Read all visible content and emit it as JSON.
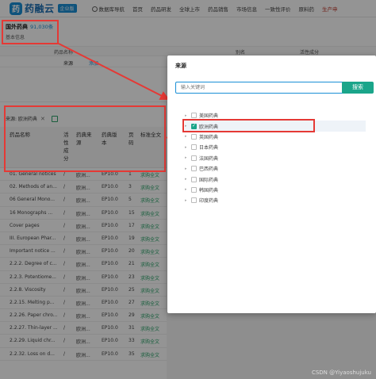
{
  "app": {
    "logo_char": "药",
    "logo_text": "药融云",
    "badge": "企业版",
    "nav": [
      "数据库导航",
      "首页",
      "药品研发",
      "全球上市",
      "药品销售",
      "市场信息",
      "一致性评价",
      "原料药",
      "生产申"
    ]
  },
  "page": {
    "title": "国外药典",
    "count": "91,030条",
    "basic_info": "基本信息"
  },
  "upper_table": {
    "headers": [
      "药品名称",
      "别名",
      "活性成分"
    ],
    "row": {
      "source": "来源",
      "link": "添加"
    }
  },
  "filter": {
    "tag": "来源: 欧洲药典",
    "close": "✕"
  },
  "grid": {
    "headers": [
      "药品名称",
      "活\n性\n成\n分",
      "药典来\n源",
      "药典版\n本",
      "页\n码",
      "标准全文"
    ],
    "rows": [
      [
        "01. General notices",
        "/",
        "欧洲...",
        "EP10.0",
        "1",
        "求购全文"
      ],
      [
        "02. Methods of an...",
        "/",
        "欧洲...",
        "EP10.0",
        "3",
        "求购全文"
      ],
      [
        "06 General Mono...",
        "/",
        "欧洲...",
        "EP10.0",
        "5",
        "求购全文"
      ],
      [
        "16 Monographs ...",
        "/",
        "欧洲...",
        "EP10.0",
        "15",
        "求购全文"
      ],
      [
        "Cover pages",
        "/",
        "欧洲...",
        "EP10.0",
        "17",
        "求购全文"
      ],
      [
        "III. European Phar...",
        "/",
        "欧洲...",
        "EP10.0",
        "19",
        "求购全文"
      ],
      [
        "Important notice ...",
        "/",
        "欧洲...",
        "EP10.0",
        "20",
        "求购全文"
      ],
      [
        "2.2.2. Degree of c...",
        "/",
        "欧洲...",
        "EP10.0",
        "21",
        "求购全文"
      ],
      [
        "2.2.3. Potentiome...",
        "/",
        "欧洲...",
        "EP10.0",
        "23",
        "求购全文"
      ],
      [
        "2.2.8. Viscosity",
        "/",
        "欧洲...",
        "EP10.0",
        "25",
        "求购全文"
      ],
      [
        "2.2.15. Melting p...",
        "/",
        "欧洲...",
        "EP10.0",
        "27",
        "求购全文"
      ],
      [
        "2.2.26. Paper chro...",
        "/",
        "欧洲...",
        "EP10.0",
        "29",
        "求购全文"
      ],
      [
        "2.2.27. Thin-layer ...",
        "/",
        "欧洲...",
        "EP10.0",
        "31",
        "求购全文"
      ],
      [
        "2.2.29. Liquid chr...",
        "/",
        "欧洲...",
        "EP10.0",
        "33",
        "求购全文"
      ],
      [
        "2.2.32. Loss on d...",
        "/",
        "欧洲...",
        "EP10.0",
        "35",
        "求购全文"
      ]
    ]
  },
  "dialog": {
    "title": "来源",
    "search_placeholder": "输入关键词",
    "search_button": "搜索",
    "items": [
      {
        "label": "美国药典",
        "checked": false
      },
      {
        "label": "欧洲药典",
        "checked": true
      },
      {
        "label": "英国药典",
        "checked": false
      },
      {
        "label": "日本药典",
        "checked": false
      },
      {
        "label": "法国药典",
        "checked": false
      },
      {
        "label": "巴西药典",
        "checked": false
      },
      {
        "label": "国际药典",
        "checked": false
      },
      {
        "label": "韩国药典",
        "checked": false
      },
      {
        "label": "印度药典",
        "checked": false
      }
    ]
  },
  "colors": {
    "accent": "#1a8fd6",
    "green": "#1aa58a",
    "annotation": "#e53935"
  },
  "watermark": "CSDN @Yiyaoshujuku"
}
